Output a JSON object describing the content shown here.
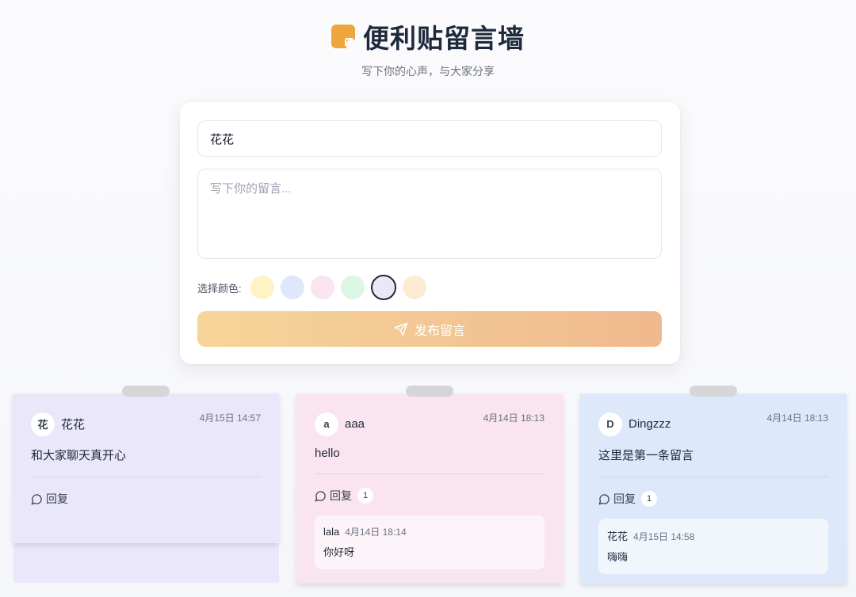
{
  "header": {
    "title": "便利贴留言墙",
    "subtitle": "写下你的心声，与大家分享"
  },
  "form": {
    "name_value": "花花",
    "message_placeholder": "写下你的留言...",
    "color_label": "选择颜色:",
    "colors": [
      "#fdf3c4",
      "#dde8fb",
      "#f9e4ef",
      "#dcf6e6",
      "#ebe7fb",
      "#fdebd3"
    ],
    "selected_color_index": 4,
    "publish_label": "发布留言"
  },
  "notes": [
    {
      "author": "花花",
      "avatar": "花",
      "time": "4月15日 14:57",
      "text": "和大家聊天真开心",
      "reply_label": "回复",
      "reply_count": "",
      "color": "#ebe7fb",
      "replies": []
    },
    {
      "author": "aaa",
      "avatar": "a",
      "time": "4月14日 18:13",
      "text": "hello",
      "reply_label": "回复",
      "reply_count": "1",
      "color": "#f9e4ef",
      "replies": [
        {
          "author": "lala",
          "time": "4月14日 18:14",
          "text": "你好呀"
        }
      ]
    },
    {
      "author": "Dingzzz",
      "avatar": "D",
      "time": "4月14日 18:13",
      "text": "这里是第一条留言",
      "reply_label": "回复",
      "reply_count": "1",
      "color": "#dde8fb",
      "replies": [
        {
          "author": "花花",
          "time": "4月15日 14:58",
          "text": "嗨嗨"
        }
      ]
    }
  ]
}
